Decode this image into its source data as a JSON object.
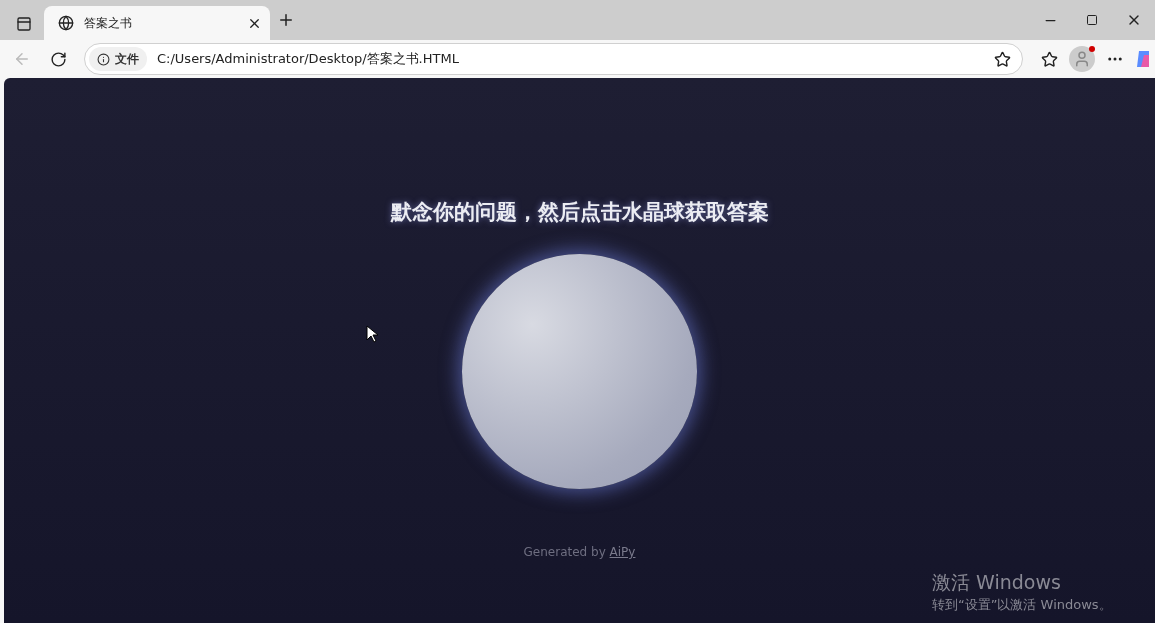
{
  "browser": {
    "tab": {
      "title": "答案之书",
      "selected": true
    },
    "address": {
      "security_label": "文件",
      "url": "C:/Users/Administrator/Desktop/答案之书.HTML"
    },
    "profile_notification": true
  },
  "page": {
    "heading": "默念你的问题，然后点击水晶球获取答案",
    "footer": {
      "prefix": "Generated by ",
      "link": "AiPy"
    }
  },
  "os_notice": {
    "title": "激活 Windows",
    "message": "转到“设置”以激活 Windows。"
  }
}
